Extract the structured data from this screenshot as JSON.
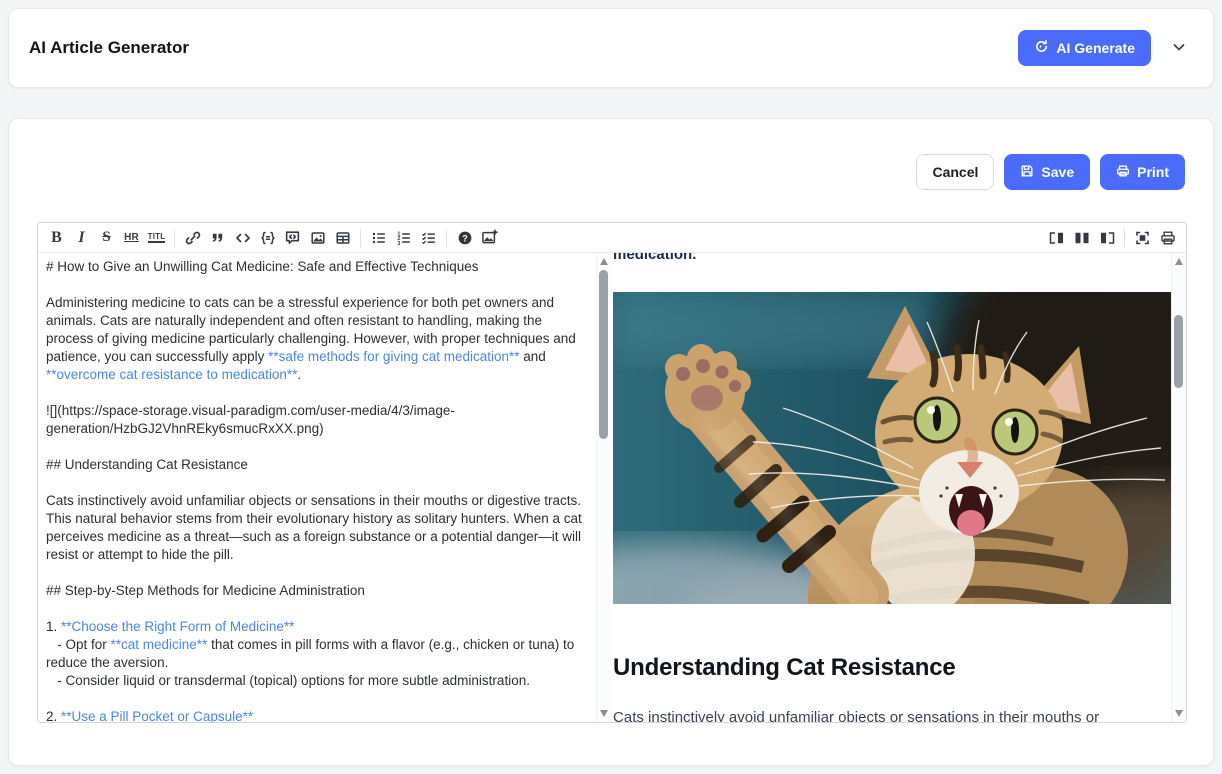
{
  "colors": {
    "primary_blue": "#4b6bfb",
    "editor_link_blue": "#4a86e8",
    "toolbar_icon": "#333a45",
    "preview_heading": "#10141c",
    "card_border": "#e6e8eb"
  },
  "header": {
    "title": "AI Article Generator",
    "generate_button_label": "AI Generate",
    "generate_button_icon": "sparkle-refresh-icon",
    "dropdown_icon": "chevron-down-icon"
  },
  "actions": {
    "cancel_label": "Cancel",
    "save_label": "Save",
    "save_icon": "floppy-disk-icon",
    "print_label": "Print",
    "print_icon": "printer-icon"
  },
  "toolbar": {
    "bold_glyph": "B",
    "italic_glyph": "I",
    "strike_glyph": "S",
    "hr_glyph": "HR",
    "title_glyph": "TITL",
    "icon_names": [
      "bold-icon",
      "italic-icon",
      "strikethrough-icon",
      "horizontal-rule-icon",
      "title-icon",
      "link-icon",
      "blockquote-icon",
      "inline-code-icon",
      "code-block-icon",
      "custom-block-icon",
      "image-icon",
      "table-icon",
      "bullet-list-icon",
      "ordered-list-icon",
      "task-list-icon",
      "help-icon",
      "ai-image-icon",
      "layout-preview-right-icon",
      "layout-split-icon",
      "layout-preview-left-icon",
      "fullscreen-icon",
      "print-preview-icon"
    ]
  },
  "editor": {
    "lines": [
      {
        "segments": [
          {
            "t": "# How to Give an Unwilling Cat Medicine: Safe and Effective Techniques",
            "k": "p"
          }
        ]
      },
      {
        "segments": []
      },
      {
        "segments": [
          {
            "t": "Administering medicine to cats can be a stressful experience for both pet owners and",
            "k": "p"
          }
        ]
      },
      {
        "segments": [
          {
            "t": "animals. Cats are naturally independent and often resistant to handling, making the",
            "k": "p"
          }
        ]
      },
      {
        "segments": [
          {
            "t": "process of giving medicine particularly challenging. However, with proper techniques and",
            "k": "p"
          }
        ]
      },
      {
        "segments": [
          {
            "t": "patience, you can successfully apply ",
            "k": "p"
          },
          {
            "t": "**safe methods for giving cat medication**",
            "k": "l"
          },
          {
            "t": " and",
            "k": "p"
          }
        ]
      },
      {
        "segments": [
          {
            "t": "**overcome cat resistance to medication**",
            "k": "l"
          },
          {
            "t": ".",
            "k": "p"
          }
        ]
      },
      {
        "segments": []
      },
      {
        "segments": [
          {
            "t": "![](https://space-storage.visual-paradigm.com/user-media/4/3/image-",
            "k": "p"
          }
        ]
      },
      {
        "segments": [
          {
            "t": "generation/HzbGJ2VhnREky6smucRxXX.png)",
            "k": "p"
          }
        ]
      },
      {
        "segments": []
      },
      {
        "segments": [
          {
            "t": "## Understanding Cat Resistance",
            "k": "p"
          }
        ]
      },
      {
        "segments": []
      },
      {
        "segments": [
          {
            "t": "Cats instinctively avoid unfamiliar objects or sensations in their mouths or digestive tracts.",
            "k": "p"
          }
        ]
      },
      {
        "segments": [
          {
            "t": "This natural behavior stems from their evolutionary history as solitary hunters. When a cat",
            "k": "p"
          }
        ]
      },
      {
        "segments": [
          {
            "t": "perceives medicine as a threat—such as a foreign substance or a potential danger—it will",
            "k": "p"
          }
        ]
      },
      {
        "segments": [
          {
            "t": "resist or attempt to hide the pill.",
            "k": "p"
          }
        ]
      },
      {
        "segments": []
      },
      {
        "segments": [
          {
            "t": "## Step-by-Step Methods for Medicine Administration",
            "k": "p"
          }
        ]
      },
      {
        "segments": []
      },
      {
        "segments": [
          {
            "t": "1. ",
            "k": "p"
          },
          {
            "t": "**Choose the Right Form of Medicine**",
            "k": "l"
          }
        ]
      },
      {
        "segments": [
          {
            "t": "   - Opt for ",
            "k": "p"
          },
          {
            "t": "**cat medicine**",
            "k": "l"
          },
          {
            "t": " that comes in pill forms with a flavor (e.g., chicken or tuna) to",
            "k": "p"
          }
        ]
      },
      {
        "segments": [
          {
            "t": "reduce the aversion.",
            "k": "p"
          }
        ]
      },
      {
        "segments": [
          {
            "t": "   - Consider liquid or transdermal (topical) options for more subtle administration.",
            "k": "p"
          }
        ]
      },
      {
        "segments": []
      },
      {
        "segments": [
          {
            "t": "2. ",
            "k": "p"
          },
          {
            "t": "**Use a Pill Pocket or Capsule**",
            "k": "l"
          }
        ]
      }
    ]
  },
  "preview": {
    "clipped_bold_text": "medication.",
    "image_alt": "tabby cat with raised paw on teal background",
    "heading": "Understanding Cat Resistance",
    "paragraph": "Cats instinctively avoid unfamiliar objects or sensations in their mouths or"
  }
}
